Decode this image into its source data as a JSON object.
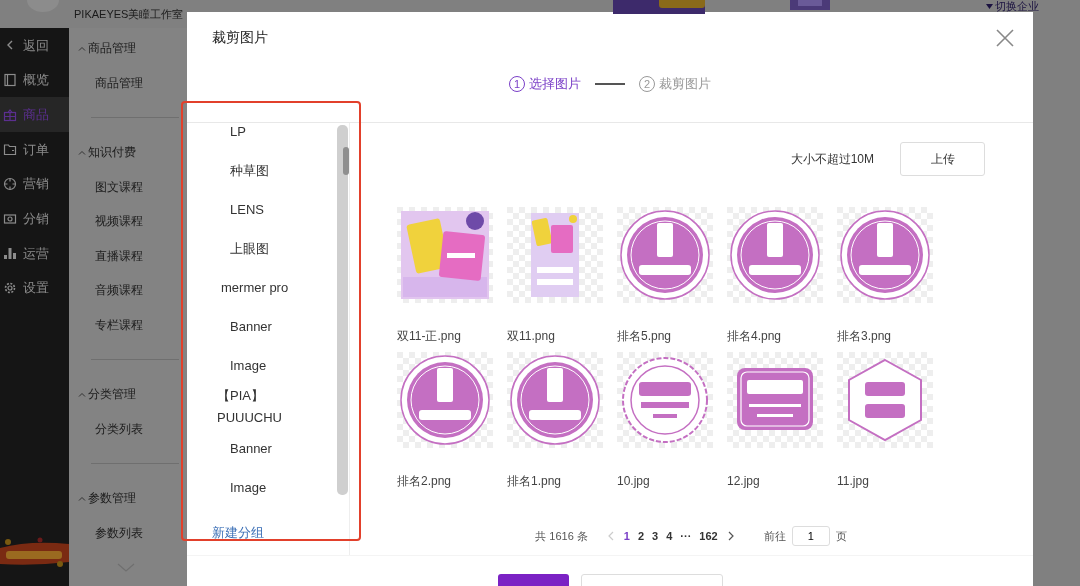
{
  "topbar": {
    "shop_name": "PIKAEYES美瞳工作室",
    "switch_label": "切换企业"
  },
  "sidebar": {
    "items": [
      {
        "label": "返回",
        "selected": false
      },
      {
        "label": "概览",
        "selected": false
      },
      {
        "label": "商品",
        "selected": true
      },
      {
        "label": "订单",
        "selected": false
      },
      {
        "label": "营销",
        "selected": false
      },
      {
        "label": "分销",
        "selected": false
      },
      {
        "label": "运营",
        "selected": false
      },
      {
        "label": "设置",
        "selected": false
      }
    ]
  },
  "subnav": {
    "sections": [
      {
        "title": "商品管理",
        "expanded": true,
        "items": [
          "商品管理"
        ]
      },
      {
        "title": "知识付费",
        "expanded": true,
        "items": [
          "图文课程",
          "视频课程",
          "直播课程",
          "音频课程",
          "专栏课程"
        ]
      },
      {
        "title": "分类管理",
        "expanded": true,
        "items": [
          "分类列表"
        ]
      },
      {
        "title": "参数管理",
        "expanded": true,
        "items": [
          "参数列表"
        ]
      }
    ]
  },
  "modal": {
    "title": "裁剪图片",
    "steps": [
      {
        "number": "1",
        "label": "选择图片",
        "selected": true
      },
      {
        "number": "2",
        "label": "裁剪图片",
        "selected": false
      }
    ],
    "groups": [
      {
        "children": [
          "LP",
          "种草图",
          "LENS",
          "上眼图"
        ]
      },
      {
        "label": "mermer pro",
        "children": [
          "Banner",
          "Image"
        ]
      },
      {
        "label": "【PIA】",
        "label_continued": "PUUUCHU",
        "children": [
          "Banner",
          "Image"
        ]
      }
    ],
    "new_group_link": "新建分组",
    "upload_hint": "大小不超过10M",
    "upload_button": "上传",
    "images": [
      {
        "name": "双11-正.png"
      },
      {
        "name": "双11.png"
      },
      {
        "name": "排名5.png"
      },
      {
        "name": "排名4.png"
      },
      {
        "name": "排名3.png"
      },
      {
        "name": "排名2.png"
      },
      {
        "name": "排名1.png"
      },
      {
        "name": "10.jpg"
      },
      {
        "name": "12.jpg"
      },
      {
        "name": "11.jpg"
      }
    ],
    "pagination": {
      "total": "共 1616 条",
      "prev_disabled": true,
      "pages": [
        {
          "label": "1",
          "selected": true
        },
        {
          "label": "2",
          "selected": false
        },
        {
          "label": "3",
          "selected": false
        },
        {
          "label": "4",
          "selected": false
        },
        {
          "label": "···",
          "selected": false
        },
        {
          "label": "162",
          "selected": false
        }
      ],
      "goto_label": "前往",
      "goto_value": "1",
      "page_suffix": "页"
    },
    "footer_buttons": [
      {
        "kind": "primary"
      },
      {
        "kind": "secondary"
      }
    ]
  }
}
